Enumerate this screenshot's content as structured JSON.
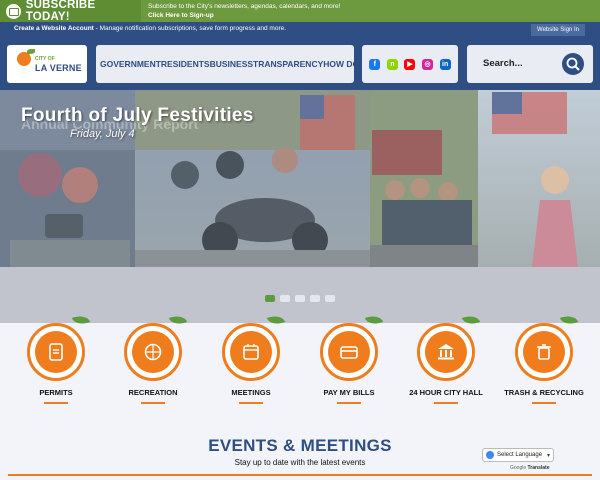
{
  "subscribe": {
    "title": "SUBSCRIBE TODAY!",
    "text": "Subscribe to the City's newsletters, agendas, calendars, and more!",
    "link": "Click Here to Sign-up"
  },
  "account": {
    "create_label": "Create a Website Account",
    "create_desc": " - Manage notification subscriptions, save form progress and more.",
    "signin_label": "Website Sign In"
  },
  "logo": {
    "small": "CITY OF",
    "main": "LA VERNE"
  },
  "nav": {
    "items": [
      "GOVERNMENT",
      "RESIDENTS",
      "BUSINESS",
      "TRANSPARENCY",
      "HOW DO I..."
    ]
  },
  "social": {
    "items": [
      {
        "name": "facebook-icon",
        "glyph": "f",
        "color": "#1877f2"
      },
      {
        "name": "nextdoor-icon",
        "glyph": "n",
        "color": "#8ed500"
      },
      {
        "name": "youtube-icon",
        "glyph": "▶",
        "color": "#ff0000"
      },
      {
        "name": "instagram-icon",
        "glyph": "◎",
        "color": "#d6249f"
      },
      {
        "name": "linkedin-icon",
        "glyph": "in",
        "color": "#0a66c2"
      }
    ]
  },
  "search": {
    "placeholder": "Search..."
  },
  "hero": {
    "title": "Fourth of July Festivities",
    "ghost": "Annual Community Report",
    "subtitle": "Friday, July 4"
  },
  "slider": {
    "count": 5,
    "active": 0
  },
  "quicklinks": [
    {
      "label": "PERMITS",
      "icon": "permits-icon"
    },
    {
      "label": "RECREATION",
      "icon": "basketball-icon"
    },
    {
      "label": "MEETINGS",
      "icon": "calendar-icon"
    },
    {
      "label": "PAY MY BILLS",
      "icon": "payment-icon"
    },
    {
      "label": "24 HOUR CITY HALL",
      "icon": "city-hall-icon"
    },
    {
      "label": "TRASH & RECYCLING",
      "icon": "trash-icon"
    }
  ],
  "events": {
    "title": "EVENTS & MEETINGS",
    "subtitle": "Stay up to date with the latest events"
  },
  "translate": {
    "label": "Select Language",
    "powered": "Google",
    "translate_word": "Translate"
  },
  "colors": {
    "brand_blue": "#2e4e84",
    "brand_green": "#5d9b3f",
    "accent_orange": "#ef7c1d"
  }
}
